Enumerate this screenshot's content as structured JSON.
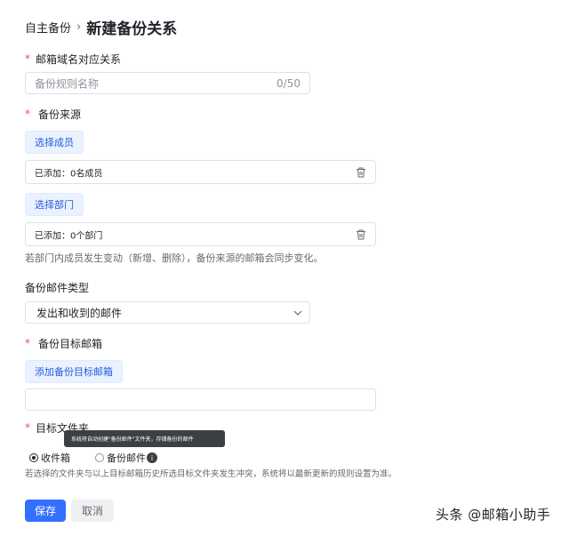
{
  "breadcrumb": {
    "parent": "自主备份",
    "separator": "›",
    "current": "新建备份关系"
  },
  "mapping": {
    "label": "邮箱域名对应关系",
    "placeholder": "备份规则名称",
    "counter": "0/50"
  },
  "source": {
    "label": "备份来源",
    "select_members_button": "选择成员",
    "members_added": "已添加：0名成员",
    "select_departments_button": "选择部门",
    "departments_added": "已添加：0个部门",
    "hint": "若部门内成员发生变动（新增、删除），备份来源的邮箱会同步变化。"
  },
  "mail_type": {
    "label": "备份邮件类型",
    "selected": "发出和收到的邮件"
  },
  "target_mailbox": {
    "label": "备份目标邮箱",
    "add_button": "添加备份目标邮箱",
    "value": ""
  },
  "target_folder": {
    "label": "目标文件夹",
    "tooltip": "系统将自动创建\"备份邮件\"文件夹，存储备份的邮件",
    "options": [
      {
        "label": "收件箱",
        "checked": true
      },
      {
        "label": "备份邮件",
        "checked": false
      }
    ],
    "info_glyph": "i",
    "hint": "若选择的文件夹与以上目标邮箱历史所选目标文件夹发生冲突，系统将以最新更新的规则设置为准。"
  },
  "required_mark": "*",
  "actions": {
    "save": "保存",
    "cancel": "取消"
  },
  "watermark": "头条 @邮箱小助手"
}
